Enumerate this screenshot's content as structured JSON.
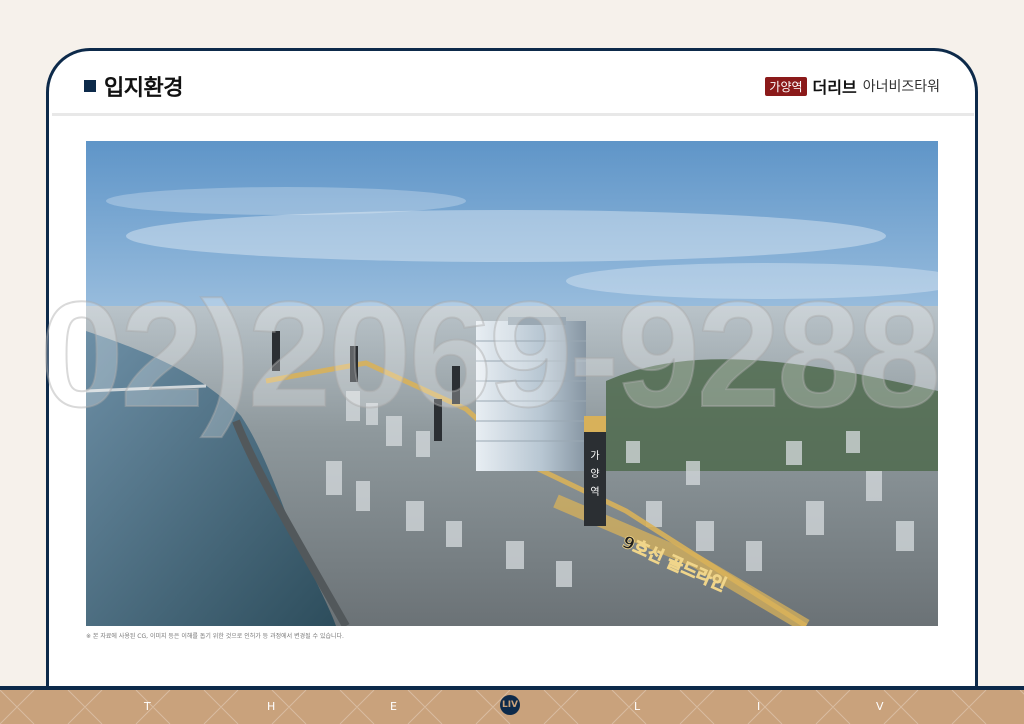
{
  "header": {
    "title": "입지환경",
    "badge": "가양역",
    "brand_bold": "더리브",
    "brand_light": "아너비즈타워"
  },
  "image": {
    "tower_sign_chars": [
      "가",
      "양",
      "역"
    ],
    "route_label": "9호선 골드라인"
  },
  "watermark": "02)2069-9288",
  "caption": "※ 본 자료에 사용된 CG, 이미지 등은 이해를 돕기 위한 것으로 인허가 등 과정에서 변경될 수 있습니다.",
  "footer": {
    "letters": [
      "T",
      "H",
      "E",
      "L",
      "I",
      "V"
    ],
    "logo": "LIV"
  },
  "colors": {
    "navy": "#0d2a4a",
    "badge_red": "#8b1a1a",
    "gold": "#c9a27c",
    "background": "#f6f1eb"
  },
  "icons": {
    "title_marker": "square-bullet-icon",
    "footer_logo": "liv-logo-icon"
  }
}
